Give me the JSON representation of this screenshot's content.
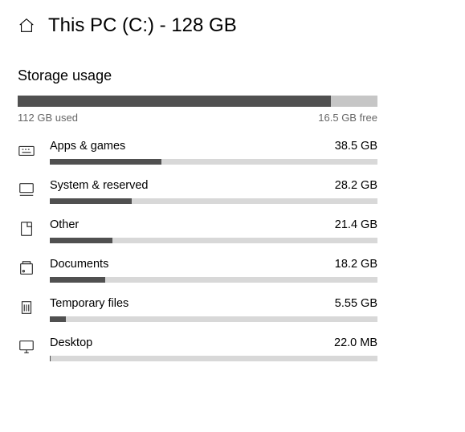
{
  "header": {
    "title": "This PC (C:) - 128 GB"
  },
  "section_heading": "Storage usage",
  "total": {
    "used_label": "112 GB used",
    "free_label": "16.5 GB free",
    "fill_percent": 87
  },
  "categories": [
    {
      "icon": "apps",
      "name": "Apps & games",
      "size": "38.5 GB",
      "fill_percent": 34
    },
    {
      "icon": "system",
      "name": "System & reserved",
      "size": "28.2 GB",
      "fill_percent": 25
    },
    {
      "icon": "other",
      "name": "Other",
      "size": "21.4 GB",
      "fill_percent": 19
    },
    {
      "icon": "documents",
      "name": "Documents",
      "size": "18.2 GB",
      "fill_percent": 17
    },
    {
      "icon": "temp",
      "name": "Temporary files",
      "size": "5.55 GB",
      "fill_percent": 5
    },
    {
      "icon": "desktop",
      "name": "Desktop",
      "size": "22.0 MB",
      "fill_percent": 0.1
    }
  ]
}
